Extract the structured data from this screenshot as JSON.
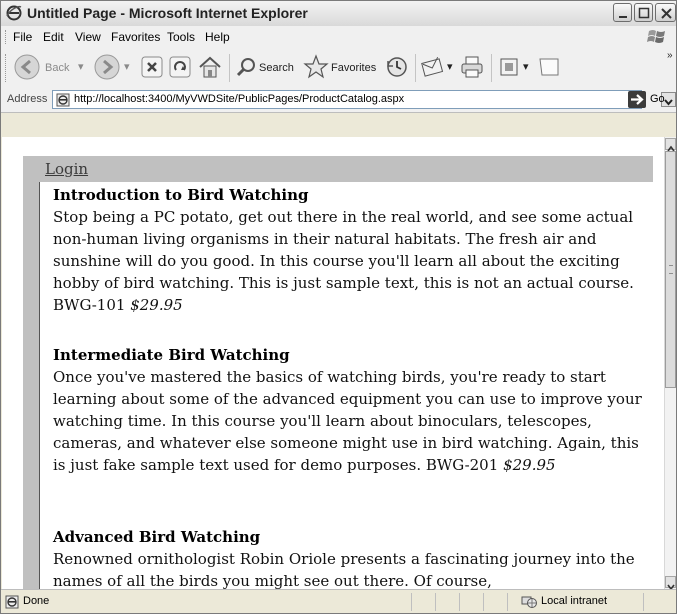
{
  "window": {
    "title": "Untitled Page - Microsoft Internet Explorer"
  },
  "menu": {
    "items": [
      "File",
      "Edit",
      "View",
      "Favorites",
      "Tools",
      "Help"
    ]
  },
  "toolbar": {
    "back_label": "Back",
    "search_label": "Search",
    "favorites_label": "Favorites"
  },
  "address": {
    "label": "Address",
    "url": "http://localhost:3400/MyVWDSite/PublicPages/ProductCatalog.aspx",
    "go_label": "Go"
  },
  "page": {
    "login_label": "Login",
    "courses": [
      {
        "title": "Introduction to Bird Watching",
        "description": "Stop being a PC potato, get out there in the real world, and see some actual non-human living organisms in their natural habitats. The fresh air and sunshine will do you good. In this course you'll learn all about the exciting hobby of bird watching. This is just sample text, this is not an actual course. BWG-101",
        "price": "$29.95"
      },
      {
        "title": "Intermediate Bird Watching",
        "description": "Once you've mastered the basics of watching birds, you're ready to start learning about some of the advanced equipment you can use to improve your watching time. In this course you'll learn about binoculars, telescopes, cameras, and whatever else someone might use in bird watching. Again, this is just fake sample text used for demo purposes. BWG-201",
        "price": "$29.95"
      },
      {
        "title": "Advanced Bird Watching",
        "description": "Renowned ornithologist Robin Oriole presents a fascinating journey into the names of all the birds you might see out there. Of course,",
        "price": ""
      }
    ]
  },
  "status": {
    "text": "Done",
    "zone": "Local intranet"
  },
  "colors": {
    "login_bar": "#c0c0c0",
    "chrome": "#ece9d8"
  }
}
